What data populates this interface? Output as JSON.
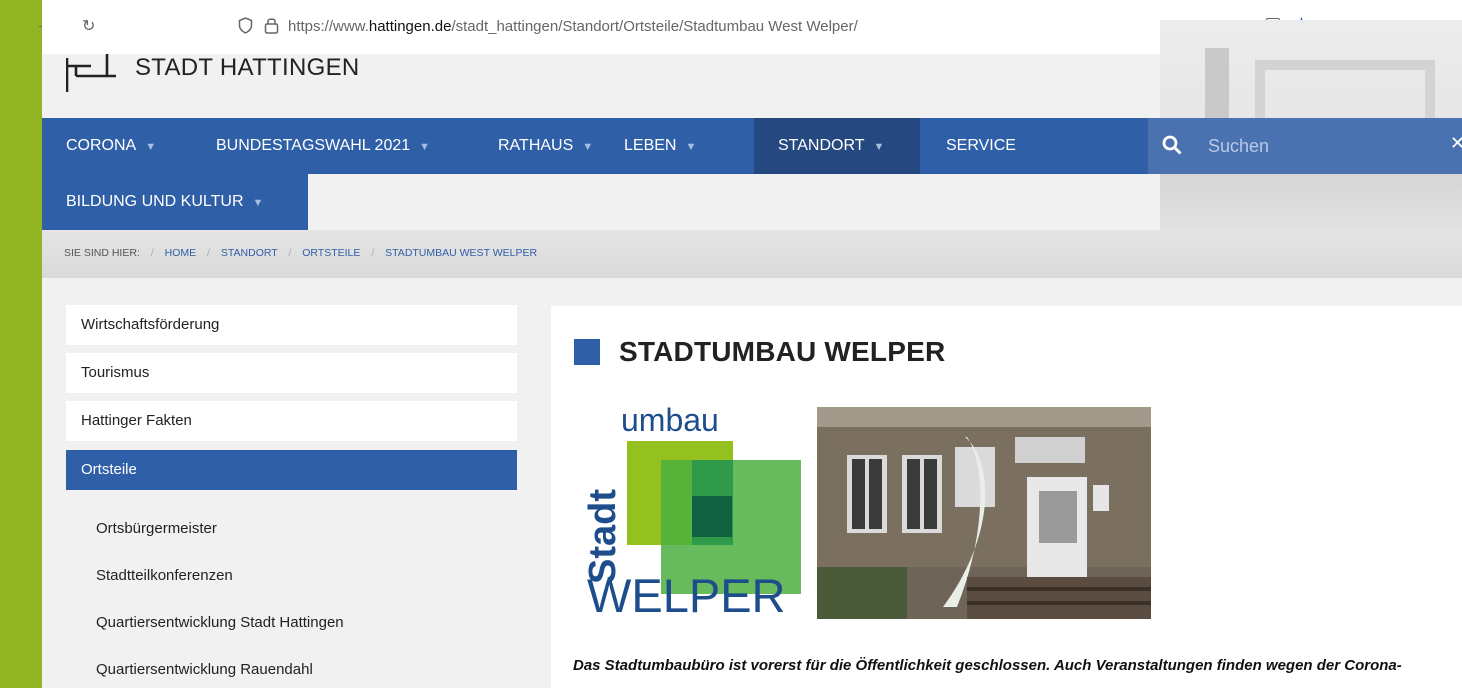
{
  "browser": {
    "url_prefix": "https://www.",
    "url_domain": "hattingen.de",
    "url_path": "/stadt_hattingen/Standort/Ortsteile/Stadtumbau West Welper/"
  },
  "site": {
    "logo_text": "STADT HATTINGEN"
  },
  "nav": {
    "items": [
      {
        "label": "CORONA"
      },
      {
        "label": "BUNDESTAGSWAHL 2021"
      },
      {
        "label": "RATHAUS"
      },
      {
        "label": "LEBEN"
      },
      {
        "label": "STANDORT"
      },
      {
        "label": "SERVICE"
      },
      {
        "label": "BILDUNG UND KULTUR"
      }
    ],
    "search_placeholder": "Suchen"
  },
  "breadcrumb": {
    "label": "SIE SIND HIER:",
    "items": [
      "HOME",
      "STANDORT",
      "ORTSTEILE",
      "STADTUMBAU WEST WELPER"
    ]
  },
  "sidebar": {
    "items": [
      {
        "label": "Wirtschaftsförderung"
      },
      {
        "label": "Tourismus"
      },
      {
        "label": "Hattinger Fakten"
      },
      {
        "label": "Ortsteile"
      }
    ],
    "subitems": [
      {
        "label": "Ortsbürgermeister"
      },
      {
        "label": "Stadtteilkonferenzen"
      },
      {
        "label": "Quartiersentwicklung Stadt Hattingen"
      },
      {
        "label": "Quartiersentwicklung Rauendahl"
      }
    ]
  },
  "main": {
    "title": "STADTUMBAU WELPER",
    "logo_word_top": "umbau",
    "logo_word_side": "Stadt",
    "logo_word_bottom": "WELPER",
    "paragraph_line1": "Das Stadtumbaubüro ist vorerst für die Öffentlichkeit geschlossen. Auch Veranstaltungen finden wegen der Corona-"
  },
  "colors": {
    "accent_green": "#94b523",
    "nav_blue": "#2f5fa7",
    "nav_active": "#24487f",
    "star_blue": "#1a6fe0"
  }
}
